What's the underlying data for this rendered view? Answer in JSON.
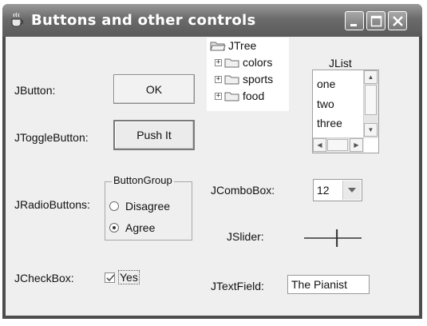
{
  "window": {
    "title": "Buttons and other controls",
    "icon": "coffee-cup-icon",
    "controls": [
      "minimize-icon",
      "maximize-icon",
      "close-icon"
    ]
  },
  "labels": {
    "jbutton": "JButton:",
    "jtogglebutton": "JToggleButton:",
    "jradiobuttons": "JRadioButtons:",
    "jcheckbox": "JCheckBox:",
    "jcombobox": "JComboBox:",
    "jslider": "JSlider:",
    "jtextfield": "JTextField:",
    "jlist": "JList"
  },
  "buttons": {
    "ok_label": "OK",
    "toggle_label": "Push It"
  },
  "tree": {
    "root": "JTree",
    "children": [
      "colors",
      "sports",
      "food"
    ]
  },
  "list": {
    "items": [
      "one",
      "two",
      "three"
    ]
  },
  "radio_group": {
    "title": "ButtonGroup",
    "options": [
      {
        "label": "Disagree",
        "selected": false
      },
      {
        "label": "Agree",
        "selected": true
      }
    ]
  },
  "combobox": {
    "selected": "12"
  },
  "slider": {
    "value": 0.58
  },
  "checkbox": {
    "label": "Yes",
    "checked": true
  },
  "textfield": {
    "value": "The Pianist"
  }
}
